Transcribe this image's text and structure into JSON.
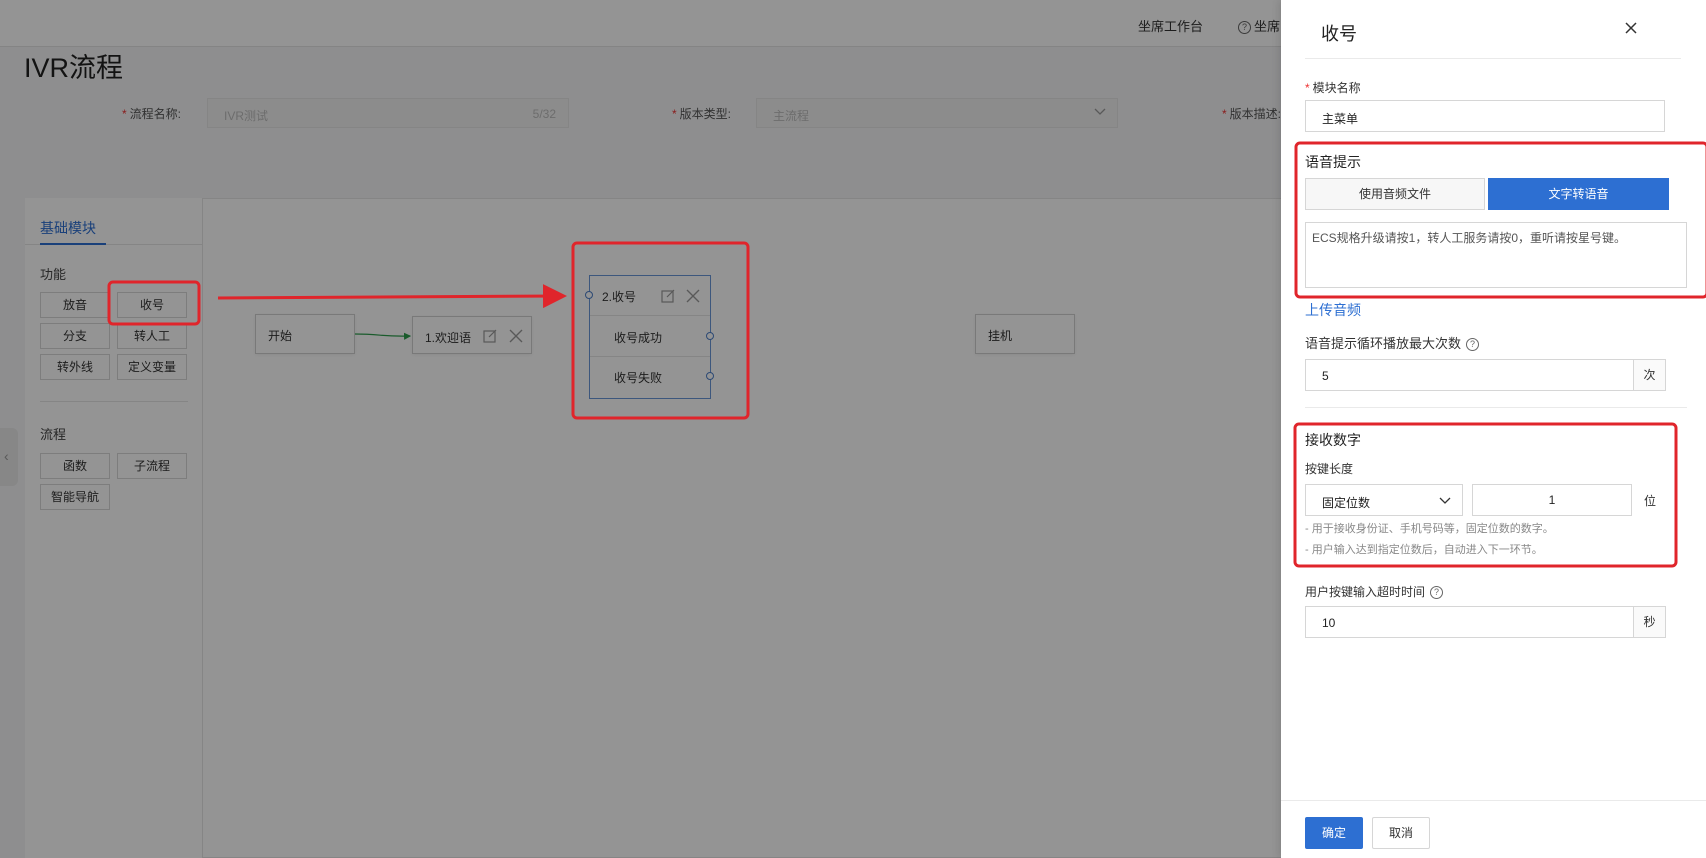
{
  "topbar": {
    "agent_workbench": "坐席工作台",
    "help_link": "坐席"
  },
  "page": {
    "title": "IVR流程",
    "fields": {
      "flow_name_label": "流程名称:",
      "flow_name_value": "IVR测试",
      "flow_name_count": "5/32",
      "version_type_label": "版本类型:",
      "version_type_value": "主流程",
      "version_desc_label": "版本描述:"
    }
  },
  "modules": {
    "tab": "基础模块",
    "function_group": "功能",
    "function_items": [
      "放音",
      "收号",
      "分支",
      "转人工",
      "转外线",
      "定义变量"
    ],
    "process_group": "流程",
    "process_items": [
      "函数",
      "子流程",
      "智能导航"
    ]
  },
  "flow": {
    "start": "开始",
    "welcome": "1.欢迎语",
    "receive": "2.收号",
    "receive_success": "收号成功",
    "receive_fail": "收号失败",
    "hangup": "挂机"
  },
  "drawer": {
    "title": "收号",
    "module_name_label": "模块名称",
    "module_name_value": "主菜单",
    "voice_prompt_title": "语音提示",
    "use_audio_file": "使用音频文件",
    "text_to_speech": "文字转语音",
    "tts_text": "ECS规格升级请按1，转人工服务请按0，重听请按星号键。",
    "upload_audio": "上传音频",
    "loop_label": "语音提示循环播放最大次数",
    "loop_value": "5",
    "loop_unit": "次",
    "receive_digits_title": "接收数字",
    "key_length_label": "按键长度",
    "key_length_mode": "固定位数",
    "key_length_value": "1",
    "key_length_unit": "位",
    "hint1": "- 用于接收身份证、手机号码等，固定位数的数字。",
    "hint2": "- 用户输入达到指定位数后，自动进入下一环节。",
    "timeout_label": "用户按键输入超时时间",
    "timeout_value": "10",
    "timeout_unit": "秒",
    "ok": "确定",
    "cancel": "取消"
  },
  "colors": {
    "primary": "#2d6fd2",
    "annotation": "#e0252b"
  }
}
